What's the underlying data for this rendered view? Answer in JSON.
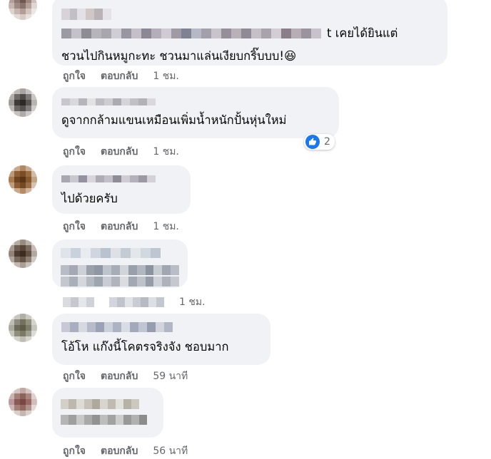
{
  "comments": [
    {
      "text_lines": [
        "t เคยได้ยินแต่",
        "ชวนไปกินหมูกะทะ ชวนมาแล่นเงียบกริ๊บบบ!😆"
      ],
      "actions": {
        "like": "ถูกใจ",
        "reply": "ตอบกลับ",
        "time": "1 ชม."
      }
    },
    {
      "text_lines": [
        "ดูจากกล้ามแขนเหมือนเพิ่มน้ำหนักปั้นหุ่นใหม่"
      ],
      "actions": {
        "like": "ถูกใจ",
        "reply": "ตอบกลับ",
        "time": "1 ชม."
      },
      "reaction_count": "2"
    },
    {
      "text_lines": [
        "ไปด้วยครับ"
      ],
      "actions": {
        "like": "ถูกใจ",
        "reply": "ตอบกลับ",
        "time": "1 ชม."
      }
    },
    {
      "text_lines": [],
      "actions": {
        "time": "1 ชม."
      }
    },
    {
      "text_lines": [
        "โอ้โห แก๊งนี้โคตรจริงจัง ชอบมาก"
      ],
      "actions": {
        "like": "ถูกใจ",
        "reply": "ตอบกลับ",
        "time": "59 นาที"
      }
    },
    {
      "text_lines": [],
      "actions": {
        "like": "ถูกใจ",
        "reply": "ตอบกลับ",
        "time": "56 นาที"
      }
    }
  ],
  "colors": {
    "bubble": "#f0f2f5",
    "meta": "#65676b",
    "like": "#1877f2"
  },
  "icons": {
    "reaction": "thumbs-up-icon"
  }
}
